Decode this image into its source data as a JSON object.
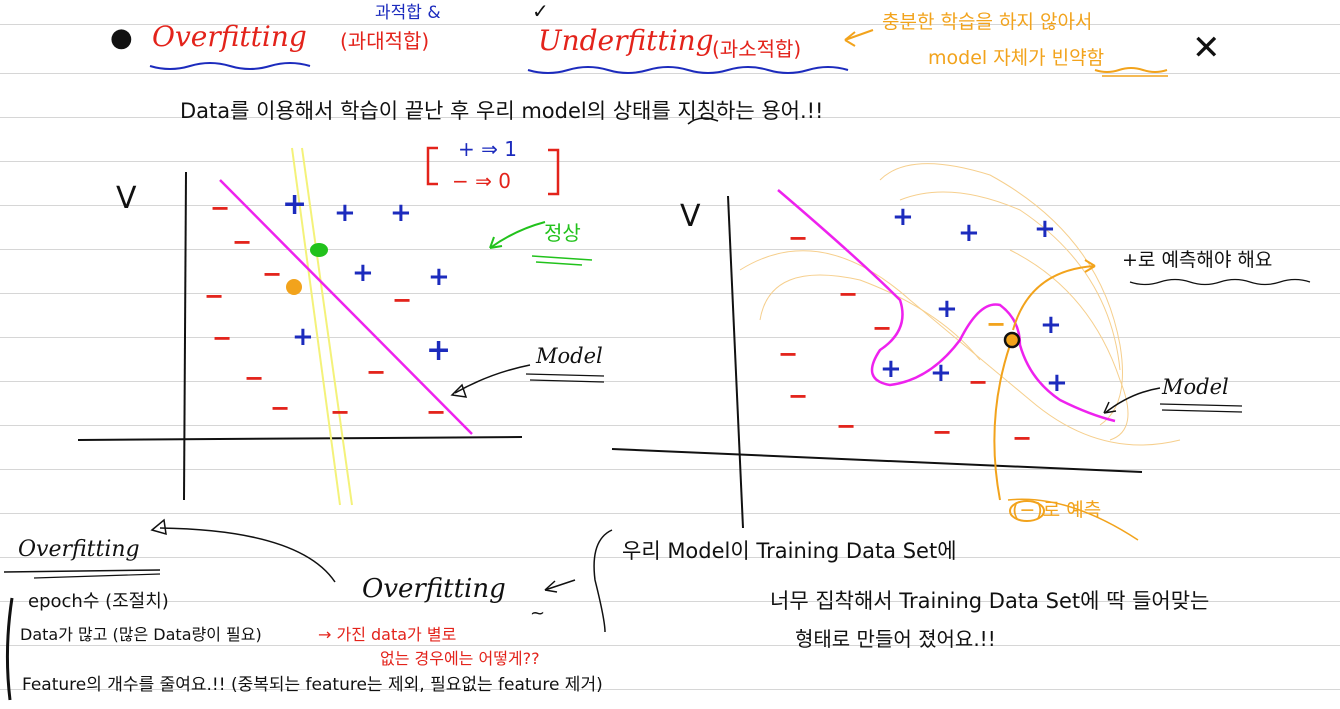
{
  "header": {
    "bullet": "●",
    "overfitting": "Overfitting",
    "overfitting_kor": "(과대적합)",
    "and_note": "과적합 &",
    "check": "✓",
    "underfitting": "Underfitting",
    "underfitting_kor": "(과소적합)",
    "under_note_1": "충분한 학습을 하지 않아서",
    "under_note_2": "model 자체가 빈약함",
    "cross": "✕"
  },
  "definition": "Data를 이용해서 학습이 끝난 후 우리 model의 상태를 지칭하는 용어.!!",
  "legend": {
    "plus_map": "+ ⇒ 1",
    "minus_map": "− ⇒ 0"
  },
  "left_graph": {
    "y_label": "V",
    "normal_label": "정상",
    "model_label": "Model",
    "plus_marks": 9,
    "minus_marks": 12
  },
  "right_graph": {
    "y_label": "V",
    "predict_plus": "+로 예측해야 해요",
    "predict_minus": "(−)로 예측",
    "model_label": "Model",
    "plus_marks": 8,
    "minus_marks": 10
  },
  "bottom": {
    "overfitting_label": "Overfitting",
    "overfitting_center": "Overfitting",
    "tilde": "~",
    "solutions": [
      "epoch수 (조절치)",
      "Data가 많고 (많은 Data량이 필요)",
      "Feature의 개수를 줄여요.!! (중복되는 feature는 제외, 필요없는 feature 제거)"
    ],
    "arrow_note_1": "→ 가진 data가 별로",
    "arrow_note_2": "없는 경우에는 어떻게??",
    "explain_1": "우리 Model이 Training Data Set에",
    "explain_2": "너무 집착해서 Training Data Set에 딱 들어맞는",
    "explain_3": "형태로 만들어 졌어요.!!"
  },
  "colors": {
    "red": "#e3231b",
    "blue": "#1c2bbd",
    "orange": "#f2a31c",
    "green": "#22c21c",
    "magenta": "#ee22ee",
    "yellow": "#f4f27a"
  }
}
